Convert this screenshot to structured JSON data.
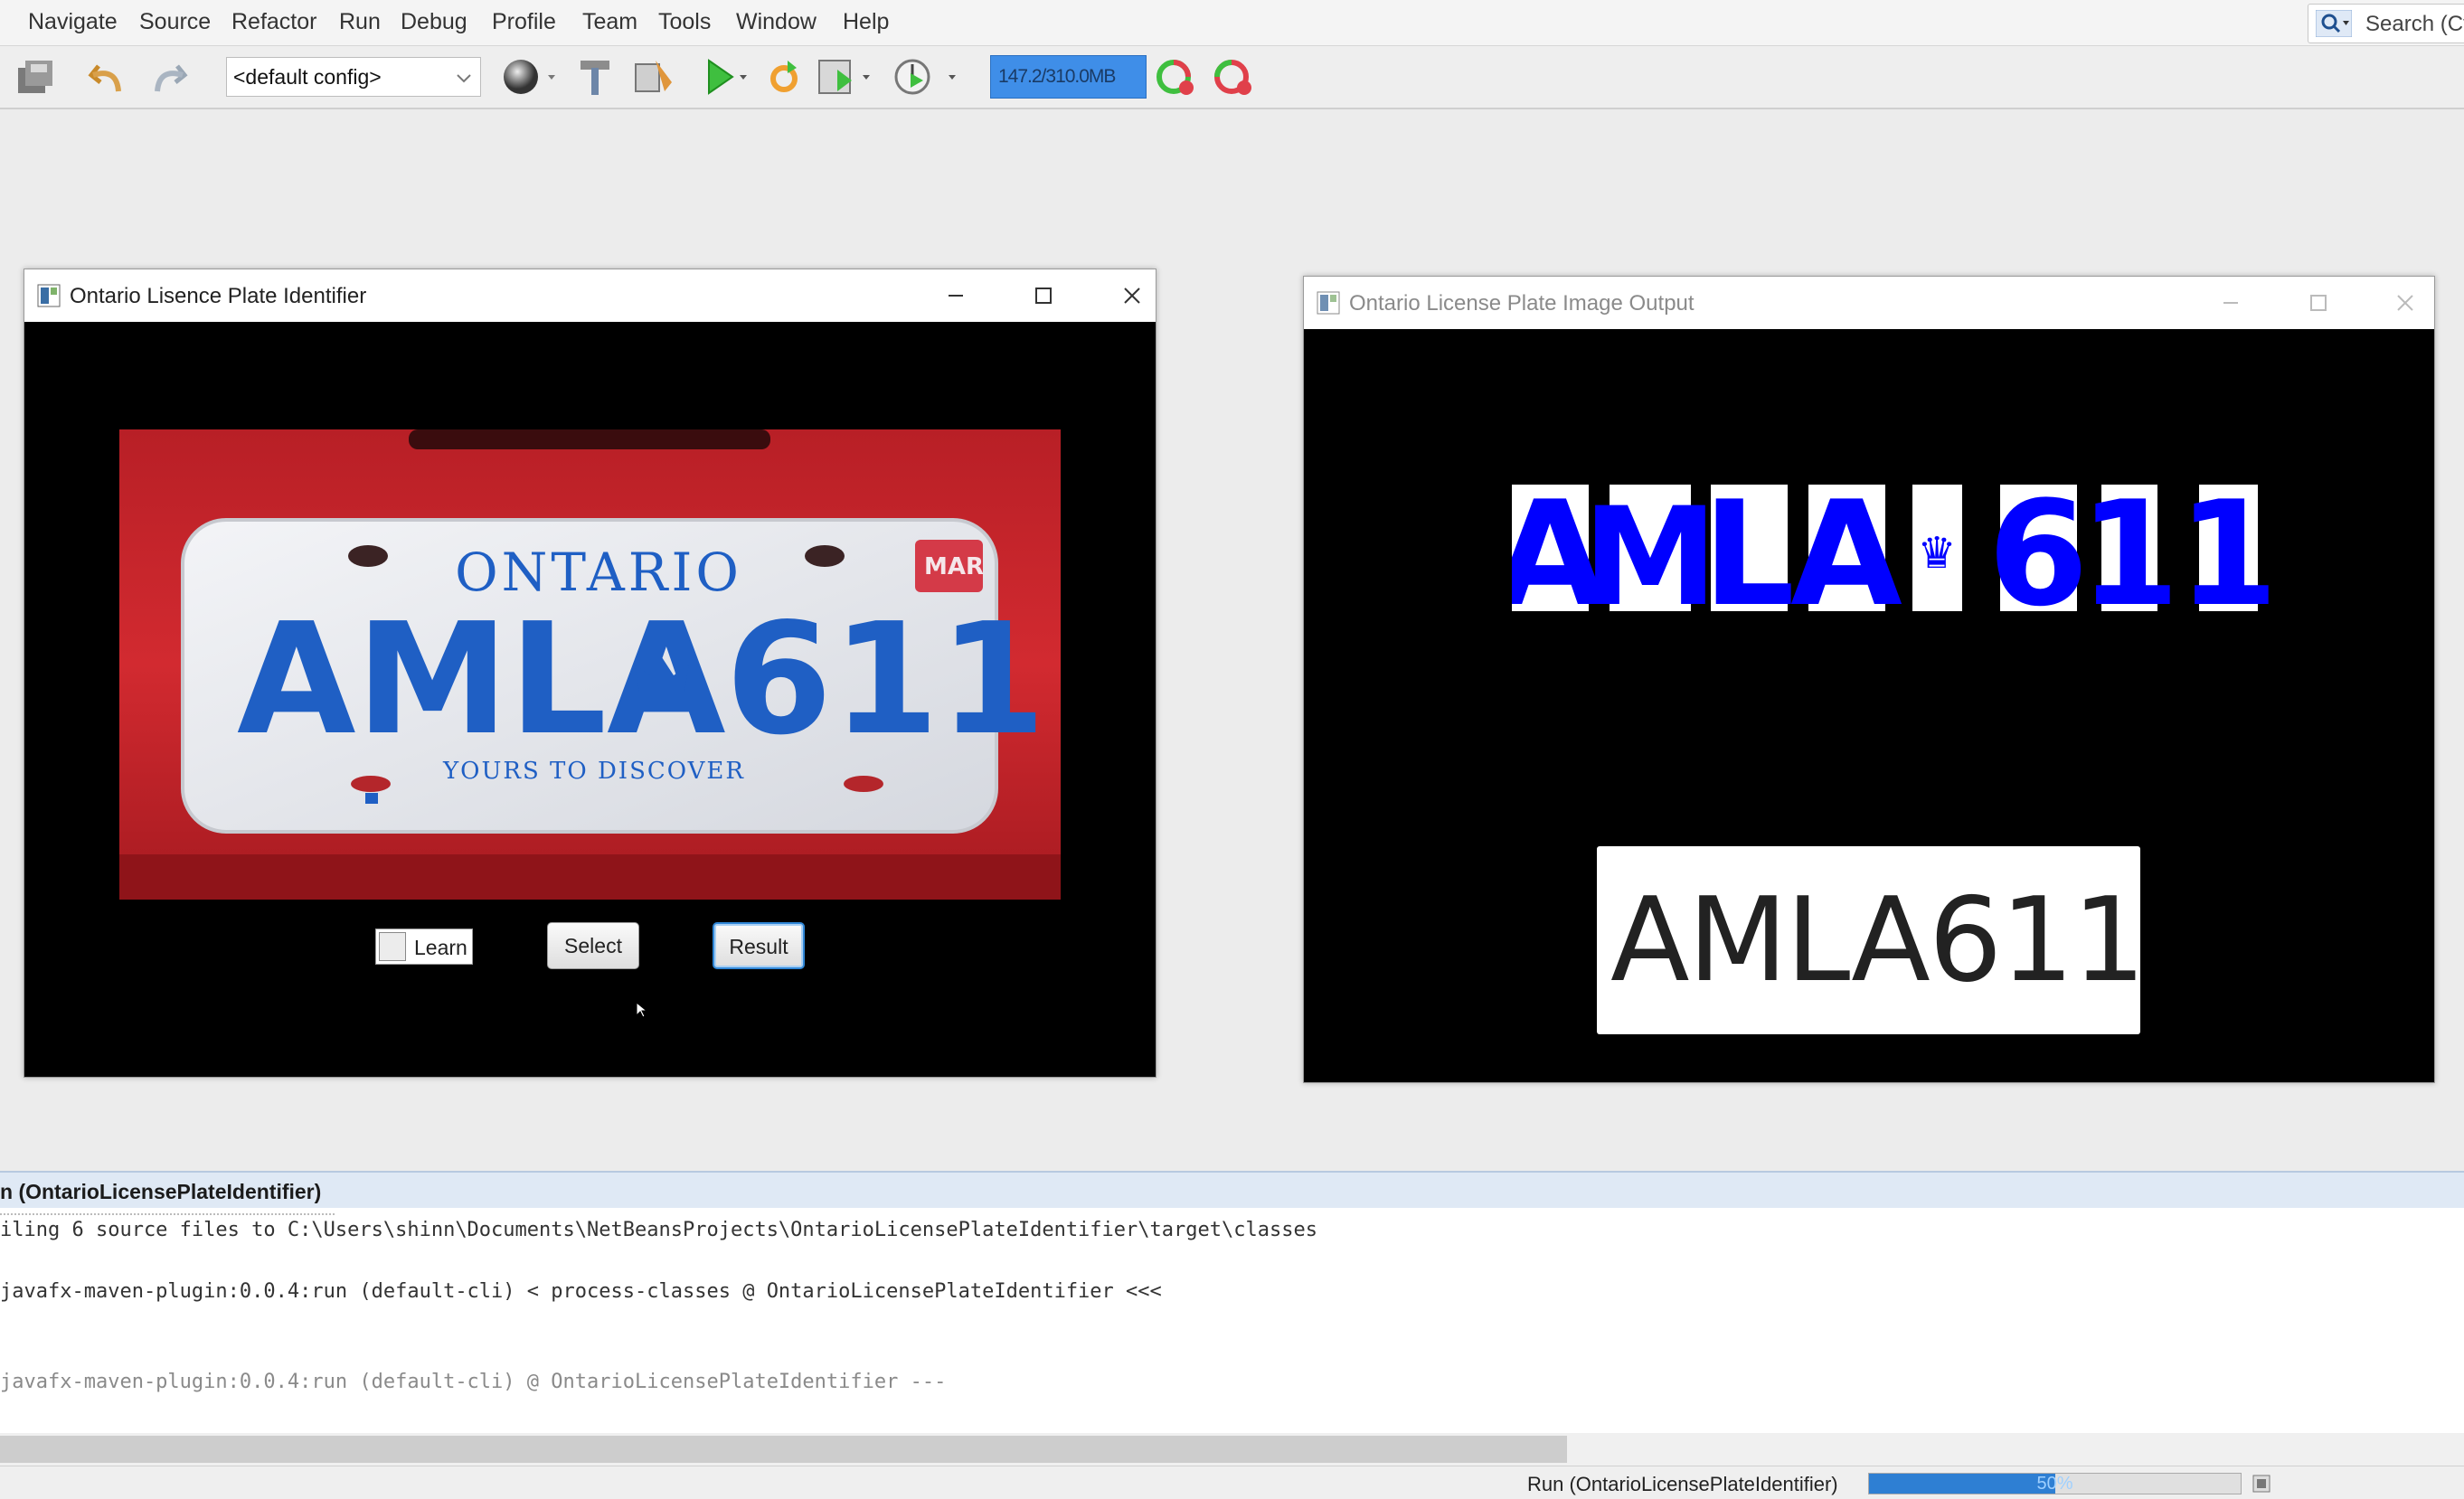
{
  "menubar": {
    "items": [
      "Navigate",
      "Source",
      "Refactor",
      "Run",
      "Debug",
      "Profile",
      "Team",
      "Tools",
      "Window",
      "Help"
    ],
    "search_placeholder": "Search (Ct"
  },
  "toolbar": {
    "config_value": "<default config>",
    "memory_label": "147.2/310.0MB",
    "icons": [
      "save-all-icon",
      "undo-icon",
      "redo-icon",
      "globe-icon",
      "build-icon",
      "clean-build-icon",
      "run-icon",
      "reload-icon",
      "debug-icon",
      "profile-icon",
      "gc-icon",
      "gc-alt-icon"
    ]
  },
  "left_window": {
    "title": "Ontario Lisence Plate Identifier",
    "plate": {
      "province": "ONTARIO",
      "number_left": "AMLA",
      "number_right": "611",
      "slogan": "YOURS TO DISCOVER",
      "sticker": "MAR"
    },
    "learn_label": "Learn",
    "select_label": "Select",
    "result_label": "Result"
  },
  "right_window": {
    "title": "Ontario License Plate Image Output",
    "segmented_chars": [
      "A",
      "M",
      "L",
      "A",
      "♛",
      "6",
      "1",
      "1"
    ],
    "result_text": "AMLA611"
  },
  "output": {
    "header": "n (OntarioLicensePlateIdentifier)",
    "lines": [
      "iling 6 source files to C:\\Users\\shinn\\Documents\\NetBeansProjects\\OntarioLicensePlateIdentifier\\target\\classes",
      "javafx-maven-plugin:0.0.4:run (default-cli) < process-classes @ OntarioLicensePlateIdentifier <<<",
      "javafx-maven-plugin:0.0.4:run (default-cli) @ OntarioLicensePlateIdentifier ---"
    ]
  },
  "status": {
    "text": "Run (OntarioLicensePlateIdentifier)",
    "progress_percent": 50,
    "progress_label": "50%"
  },
  "colors": {
    "accent": "#2e7fd3",
    "plate_blue": "#1f5fc4",
    "segment_blue": "#0000ff",
    "car_red": "#c9252b"
  }
}
